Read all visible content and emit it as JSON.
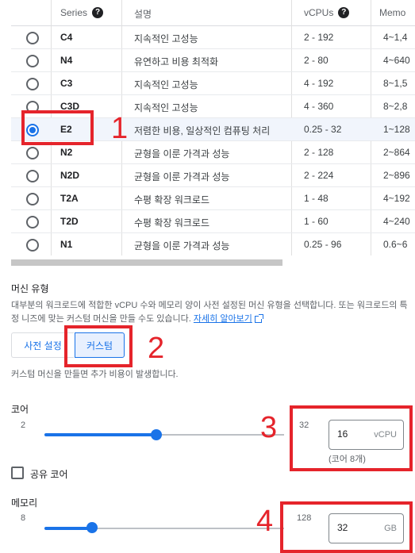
{
  "table": {
    "headers": {
      "series": "Series",
      "desc": "설명",
      "vcpus": "vCPUs",
      "memory": "Memo"
    },
    "rows": [
      {
        "series": "C4",
        "desc": "지속적인 고성능",
        "vcpus": "2 - 192",
        "mem": "4~1,4",
        "selected": false
      },
      {
        "series": "N4",
        "desc": "유연하고 비용 최적화",
        "vcpus": "2 - 80",
        "mem": "4~640",
        "selected": false
      },
      {
        "series": "C3",
        "desc": "지속적인 고성능",
        "vcpus": "4 - 192",
        "mem": "8~1,5",
        "selected": false
      },
      {
        "series": "C3D",
        "desc": "지속적인 고성능",
        "vcpus": "4 - 360",
        "mem": "8~2,8",
        "selected": false
      },
      {
        "series": "E2",
        "desc": "저렴한 비용, 일상적인 컴퓨팅 처리",
        "vcpus": "0.25 - 32",
        "mem": "1~128",
        "selected": true
      },
      {
        "series": "N2",
        "desc": "균형을 이룬 가격과 성능",
        "vcpus": "2 - 128",
        "mem": "2~864",
        "selected": false
      },
      {
        "series": "N2D",
        "desc": "균형을 이룬 가격과 성능",
        "vcpus": "2 - 224",
        "mem": "2~896",
        "selected": false
      },
      {
        "series": "T2A",
        "desc": "수평 확장 워크로드",
        "vcpus": "1 - 48",
        "mem": "4~192",
        "selected": false
      },
      {
        "series": "T2D",
        "desc": "수평 확장 워크로드",
        "vcpus": "1 - 60",
        "mem": "4~240",
        "selected": false
      },
      {
        "series": "N1",
        "desc": "균형을 이룬 가격과 성능",
        "vcpus": "0.25 - 96",
        "mem": "0.6~6",
        "selected": false
      }
    ]
  },
  "machine_type": {
    "title": "머신 유형",
    "description": "대부분의 워크로드에 적합한 vCPU 수와 메모리 양이 사전 설정된 머신 유형을 선택합니다. 또는 워크로드의 특정 니즈에 맞는 커스텀 머신을 만들 수도 있습니다.",
    "learn_more": "자세히 알아보기",
    "preset_label": "사전 설정",
    "custom_label": "커스텀",
    "custom_note": "커스텀 머신을 만들면 추가 비용이 발생합니다."
  },
  "cores": {
    "label": "코어",
    "min": "2",
    "max": "32",
    "value": "16",
    "unit": "vCPU",
    "hint": "(코어 8개)",
    "fraction": 0.467
  },
  "shared_core": {
    "label": "공유 코어",
    "checked": false
  },
  "memory": {
    "label": "메모리",
    "min": "8",
    "max": "128",
    "value": "32",
    "unit": "GB",
    "fraction": 0.2
  },
  "annotations": [
    "1",
    "2",
    "3",
    "4"
  ],
  "colors": {
    "accent": "#1a73e8",
    "annotation": "#e5242b",
    "selected_row": "#f1f5fc"
  }
}
